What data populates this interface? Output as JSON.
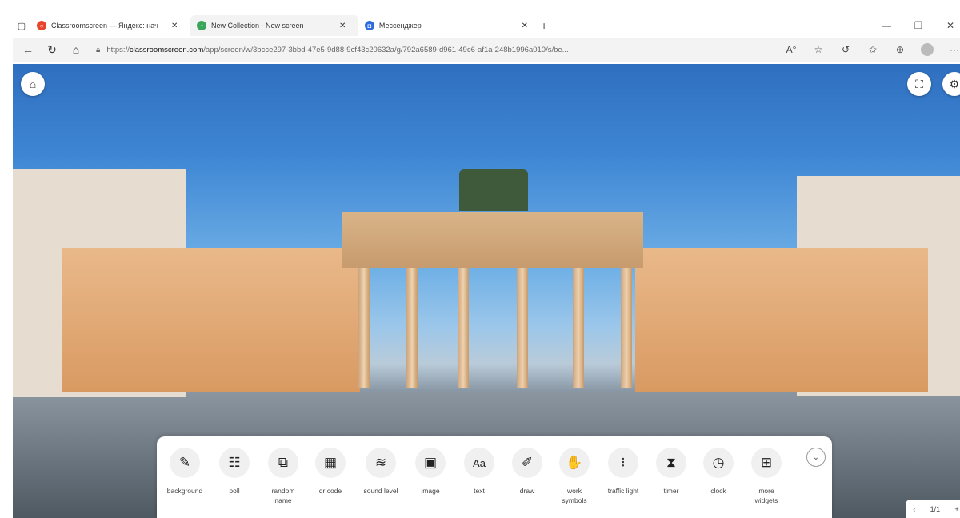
{
  "browser": {
    "tabs": [
      {
        "title": "Classroomscreen — Яндекс: нач",
        "favicon_color": "#e8452c",
        "active": false
      },
      {
        "title": "New Collection - New screen",
        "favicon_color": "#3aa65a",
        "active": true
      },
      {
        "title": "Мессенджер",
        "favicon_color": "#2d6be0",
        "active": false
      }
    ],
    "new_tab": "+",
    "address": {
      "prefix": "https://",
      "domain": "classroomscreen.com",
      "path": "/app/screen/w/3bcce297-3bbd-47e5-9d88-9cf43c20632a/g/792a6589-d961-49c6-af1a-248b1996a010/s/be..."
    }
  },
  "screen": {
    "background": "Brandenburg Gate photo"
  },
  "widgets": [
    {
      "name": "background",
      "label": "background",
      "glyph": "✎"
    },
    {
      "name": "poll",
      "label": "poll",
      "glyph": "☷"
    },
    {
      "name": "random-name",
      "label": "random name",
      "glyph": "⧉"
    },
    {
      "name": "qr-code",
      "label": "qr code",
      "glyph": "▦"
    },
    {
      "name": "sound-level",
      "label": "sound level",
      "glyph": "≋"
    },
    {
      "name": "image",
      "label": "image",
      "glyph": "▣"
    },
    {
      "name": "text",
      "label": "text",
      "glyph": "Aa"
    },
    {
      "name": "draw",
      "label": "draw",
      "glyph": "✐"
    },
    {
      "name": "work-symbols",
      "label": "work symbols",
      "glyph": "✋"
    },
    {
      "name": "traffic-light",
      "label": "traffic light",
      "glyph": "⁝"
    },
    {
      "name": "timer",
      "label": "timer",
      "glyph": "⧗"
    },
    {
      "name": "clock",
      "label": "clock",
      "glyph": "◷"
    },
    {
      "name": "more-widgets",
      "label": "more widgets",
      "glyph": "⊞"
    }
  ],
  "pager": {
    "prev": "‹",
    "page": "1/1",
    "add": "+"
  }
}
